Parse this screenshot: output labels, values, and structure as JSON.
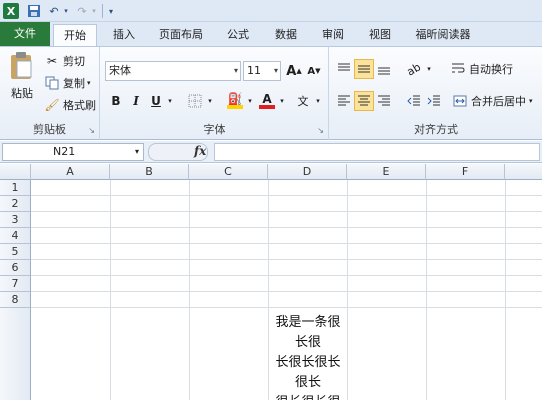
{
  "quick_access": {
    "excel_logo": "X",
    "save_icon": "save-icon",
    "undo_icon": "undo-icon",
    "redo_icon": "redo-icon"
  },
  "tabs": [
    {
      "label": "文件"
    },
    {
      "label": "开始"
    },
    {
      "label": "插入"
    },
    {
      "label": "页面布局"
    },
    {
      "label": "公式"
    },
    {
      "label": "数据"
    },
    {
      "label": "审阅"
    },
    {
      "label": "视图"
    },
    {
      "label": "福昕阅读器"
    }
  ],
  "clipboard": {
    "paste": "粘贴",
    "cut": "剪切",
    "copy": "复制",
    "format_painter": "格式刷",
    "group_title": "剪贴板"
  },
  "font": {
    "name": "宋体",
    "size": "11",
    "grow": "A",
    "shrink": "A",
    "bold": "B",
    "italic": "I",
    "underline": "U",
    "font_color_letter": "A",
    "phonetic": "文",
    "group_title": "字体"
  },
  "alignment": {
    "wrap_text": "自动换行",
    "merge_center": "合并后居中",
    "group_title": "对齐方式"
  },
  "formula_bar": {
    "name_box": "N21",
    "fx": "fx"
  },
  "columns": [
    "A",
    "B",
    "C",
    "D",
    "E",
    "F"
  ],
  "rows": [
    "1",
    "2",
    "3",
    "4",
    "5",
    "6",
    "7",
    "8"
  ],
  "cell_D8": "我是一条很\n长很\n长很长很长\n很长\n很长很长很"
}
